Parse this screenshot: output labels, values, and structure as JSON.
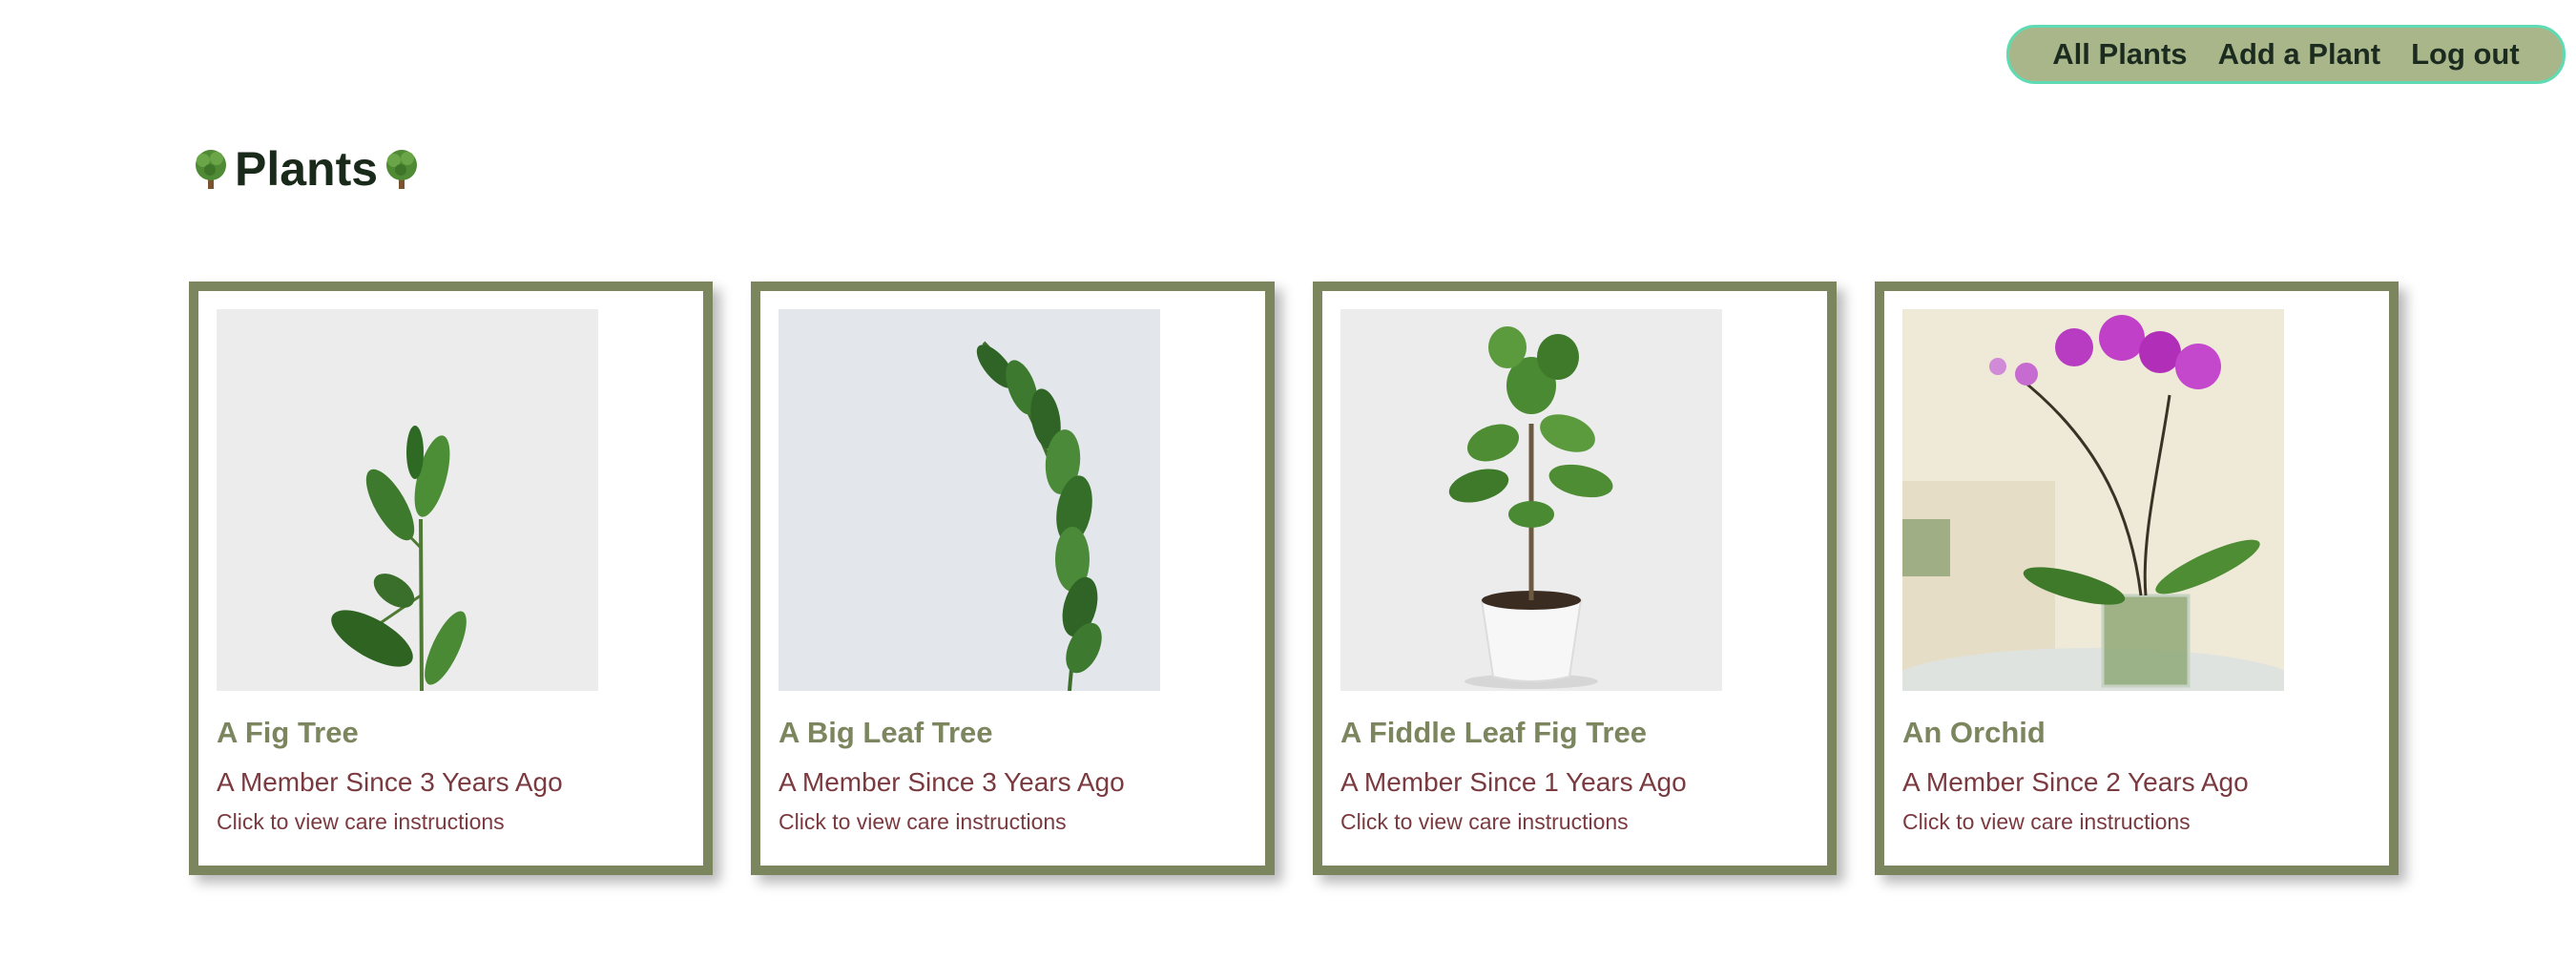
{
  "nav": {
    "items": [
      {
        "label": "All Plants"
      },
      {
        "label": "Add a Plant"
      },
      {
        "label": "Log out"
      }
    ]
  },
  "page": {
    "title": "Plants",
    "title_icon": "tree-icon"
  },
  "plants": [
    {
      "name": "A Fig Tree",
      "member_since": "A Member Since 3 Years Ago",
      "care_link": "Click to view care instructions",
      "image": "fig-tree-photo"
    },
    {
      "name": "A Big Leaf Tree",
      "member_since": "A Member Since 3 Years Ago",
      "care_link": "Click to view care instructions",
      "image": "big-leaf-tree-photo"
    },
    {
      "name": "A Fiddle Leaf Fig Tree",
      "member_since": "A Member Since 1 Years Ago",
      "care_link": "Click to view care instructions",
      "image": "fiddle-leaf-fig-photo"
    },
    {
      "name": "An Orchid",
      "member_since": "A Member Since 2 Years Ago",
      "care_link": "Click to view care instructions",
      "image": "orchid-photo"
    }
  ],
  "colors": {
    "nav_bg": "#a9b68a",
    "nav_border": "#5fdbb3",
    "card_border": "#7b865f",
    "plant_name": "#7b865f",
    "member_text": "#7a3a3f"
  }
}
